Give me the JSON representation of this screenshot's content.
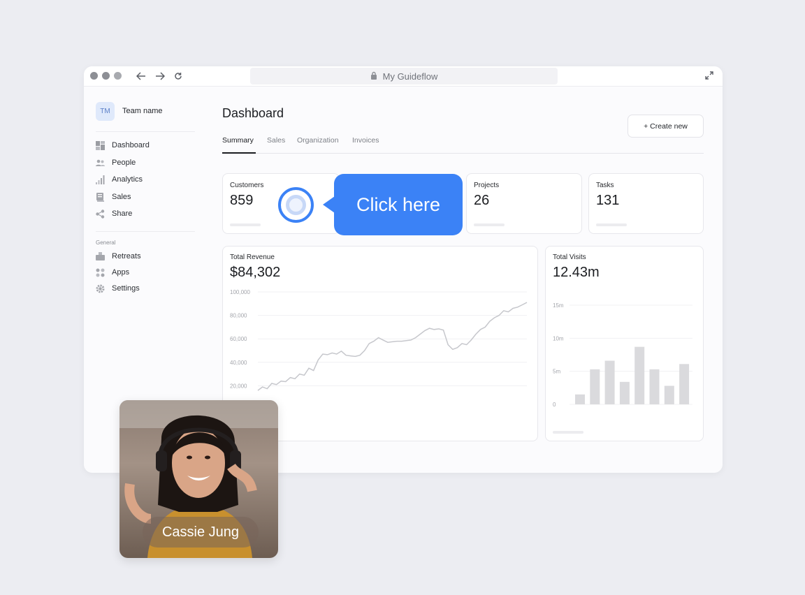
{
  "browser": {
    "url_title": "My Guideflow"
  },
  "sidebar": {
    "team_initials": "TM",
    "team_name": "Team name",
    "items": [
      {
        "label": "Dashboard",
        "icon": "dashboard-icon"
      },
      {
        "label": "People",
        "icon": "people-icon"
      },
      {
        "label": "Analytics",
        "icon": "analytics-icon"
      },
      {
        "label": "Sales",
        "icon": "sales-icon"
      },
      {
        "label": "Share",
        "icon": "share-icon"
      }
    ],
    "section_label": "General",
    "general_items": [
      {
        "label": "Retreats",
        "icon": "retreats-icon"
      },
      {
        "label": "Apps",
        "icon": "apps-icon"
      },
      {
        "label": "Settings",
        "icon": "settings-icon"
      }
    ]
  },
  "main": {
    "title": "Dashboard",
    "create_label": "+ Create new",
    "tabs": [
      "Summary",
      "Sales",
      "Organization",
      "Invoices"
    ],
    "active_tab": "Summary",
    "stats": [
      {
        "label": "Customers",
        "value": "859"
      },
      {
        "label": "Projects",
        "value": "26"
      },
      {
        "label": "Tasks",
        "value": "131"
      }
    ],
    "revenue": {
      "label": "Total Revenue",
      "value": "$84,302"
    },
    "visits": {
      "label": "Total Visits",
      "value": "12.43m"
    }
  },
  "callout": {
    "label": "Click here",
    "color": "#3b82f6"
  },
  "presenter": {
    "name": "Cassie Jung"
  },
  "chart_data": [
    {
      "type": "line",
      "title": "Total Revenue",
      "ylim": [
        0,
        100000
      ],
      "yticks": [
        "100,000",
        "80,000",
        "60,000",
        "40,000",
        "20,000"
      ],
      "series": [
        {
          "values": [
            16000,
            19000,
            17500,
            22000,
            21000,
            24000,
            23500,
            27000,
            26000,
            30000,
            29000,
            35000,
            33000,
            42000,
            47000,
            46500,
            48000,
            47000,
            49500,
            46000,
            45500,
            45000,
            46000,
            50000,
            56000,
            58000,
            61000,
            59000,
            57000,
            57500,
            58000,
            58000,
            58500,
            59000,
            61000,
            64000,
            67000,
            69000,
            68000,
            68500,
            67500,
            55000,
            51000,
            52500,
            56000,
            55000,
            59000,
            64000,
            68000,
            70000,
            75000,
            78000,
            80000,
            84000,
            83000,
            86000,
            87000,
            89000,
            91000
          ]
        }
      ]
    },
    {
      "type": "bar",
      "title": "Total Visits",
      "ylim": [
        0,
        15
      ],
      "yticks": [
        "15m",
        "10m",
        "5m",
        "0"
      ],
      "values": [
        1.5,
        5.3,
        6.6,
        3.4,
        8.7,
        5.3,
        2.8,
        6.1
      ]
    }
  ]
}
